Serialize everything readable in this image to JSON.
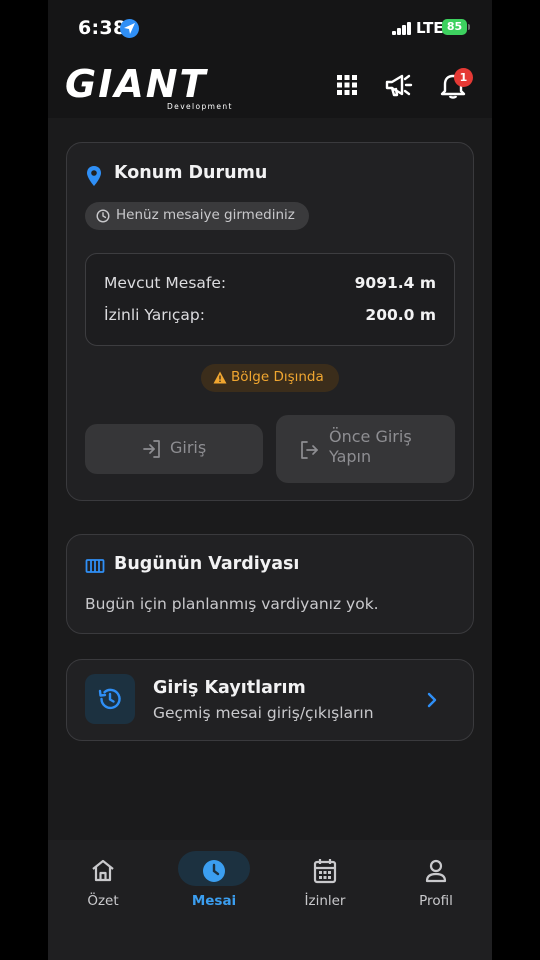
{
  "status_bar": {
    "time": "6:38",
    "network": "LTE",
    "battery": "85"
  },
  "header": {
    "logo_word": "GIANT",
    "logo_sub": "Development",
    "notification_count": "1"
  },
  "location_card": {
    "title": "Konum Durumu",
    "status_chip": "Henüz mesaiye girmediniz",
    "distance_label": "Mevcut Mesafe:",
    "distance_value": "9091.4 m",
    "radius_label": "İzinli Yarıçap:",
    "radius_value": "200.0 m",
    "zone_warning": "Bölge Dışında",
    "checkin_button": "Giriş",
    "checkout_button": "Önce Giriş Yapın"
  },
  "shift_card": {
    "title": "Bugünün Vardiyası",
    "message": "Bugün için planlanmış vardiyanız yok."
  },
  "history_card": {
    "title": "Giriş Kayıtlarım",
    "subtitle": "Geçmiş mesai giriş/çıkışların"
  },
  "bottom_nav": {
    "items": [
      {
        "label": "Özet",
        "icon": "home-icon"
      },
      {
        "label": "Mesai",
        "icon": "clock-icon",
        "active": true
      },
      {
        "label": "İzinler",
        "icon": "calendar-icon"
      },
      {
        "label": "Profil",
        "icon": "person-icon"
      }
    ]
  },
  "colors": {
    "accent": "#2f8ff6",
    "warning": "#f0a630",
    "badge": "#e53935",
    "battery": "#3dd15f"
  }
}
